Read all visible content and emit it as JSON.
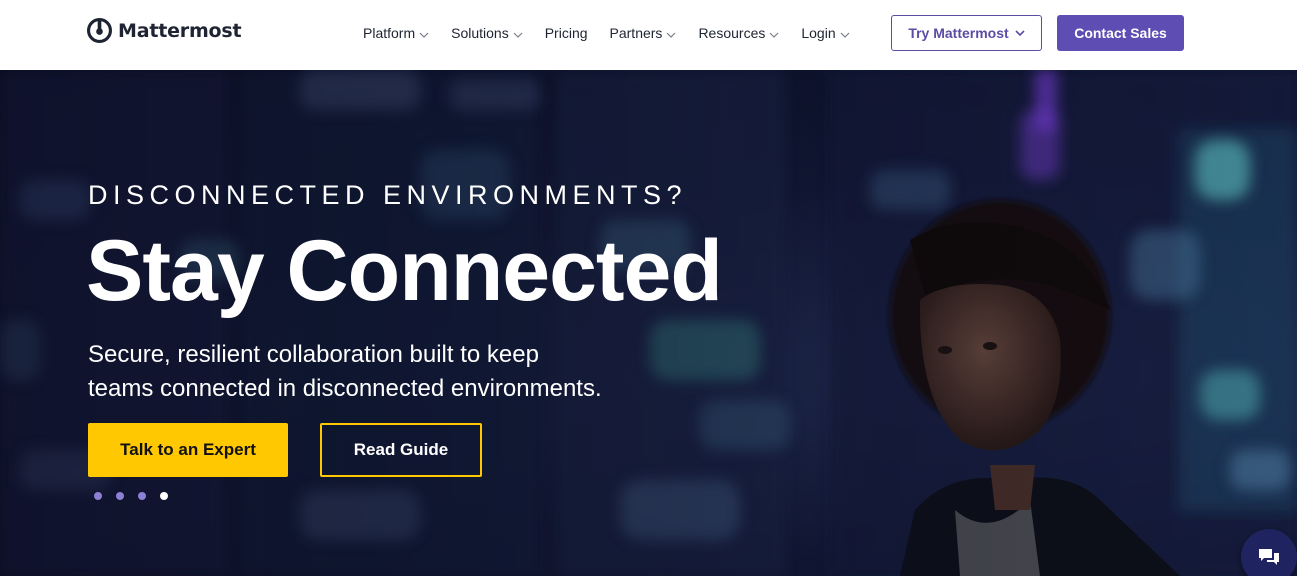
{
  "brand": {
    "name": "Mattermost"
  },
  "nav": {
    "items": [
      {
        "label": "Platform",
        "has_dropdown": true
      },
      {
        "label": "Solutions",
        "has_dropdown": true
      },
      {
        "label": "Pricing",
        "has_dropdown": false
      },
      {
        "label": "Partners",
        "has_dropdown": true
      },
      {
        "label": "Resources",
        "has_dropdown": true
      },
      {
        "label": "Login",
        "has_dropdown": true
      }
    ],
    "try_label": "Try Mattermost",
    "contact_label": "Contact Sales"
  },
  "hero": {
    "eyebrow": "DISCONNECTED ENVIRONMENTS?",
    "headline": "Stay Connected",
    "subhead_line1": "Secure, resilient collaboration built to keep",
    "subhead_line2": "teams connected in disconnected environments.",
    "primary_cta": "Talk to an Expert",
    "secondary_cta": "Read Guide",
    "carousel": {
      "total": 4,
      "active_index": 3
    }
  },
  "colors": {
    "brand_purple": "#5e4db2",
    "cta_yellow": "#ffc800",
    "hero_bg": "#141b3a"
  },
  "icons": [
    "mattermost-logo-icon",
    "chevron-down-icon",
    "chat-icon"
  ]
}
